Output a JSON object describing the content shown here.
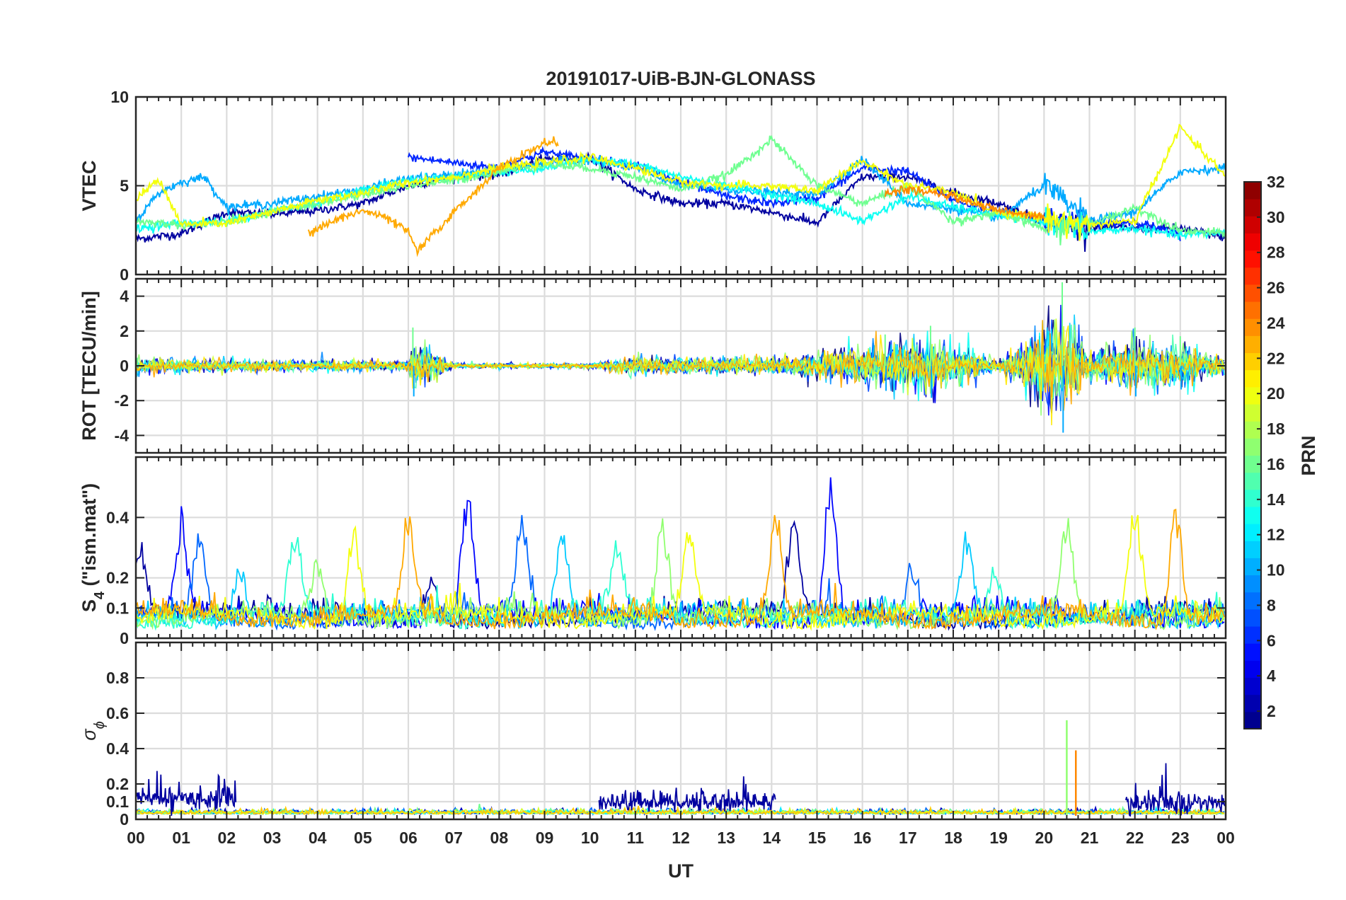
{
  "figure": {
    "title": "20191017-UiB-BJN-GLONASS",
    "xlabel": "UT",
    "colorbar_label": "PRN"
  },
  "chart_data": [
    {
      "type": "line",
      "panel": "VTEC",
      "ylabel": "VTEC",
      "ylim": [
        0,
        10
      ],
      "yticks": [
        0,
        5,
        10
      ],
      "xlim": [
        0,
        24
      ],
      "grid": true,
      "series_count_approx": 24,
      "series": [
        {
          "prn": 2,
          "x": [
            0,
            1,
            2,
            3,
            4,
            5,
            6,
            7,
            8,
            9,
            10,
            11,
            12,
            13,
            14,
            15,
            16,
            17,
            18,
            19,
            20,
            21,
            22,
            23,
            24
          ],
          "y": [
            2.0,
            2.3,
            3.5,
            3.4,
            3.6,
            4.0,
            5.0,
            5.5,
            5.6,
            6.5,
            6.6,
            4.8,
            4.0,
            4.0,
            3.5,
            2.9,
            5.5,
            5.5,
            4.6,
            4.0,
            3.0,
            2.7,
            2.6,
            2.6,
            2.1
          ]
        },
        {
          "prn": 6,
          "x": [
            6,
            7,
            8,
            8.5,
            9,
            10,
            11,
            12,
            13,
            14,
            15,
            16,
            17,
            18,
            19,
            20,
            21,
            22,
            23
          ],
          "y": [
            6.6,
            6.3,
            6.0,
            6.5,
            6.9,
            6.5,
            6.2,
            5.2,
            4.4,
            4.0,
            4.3,
            6.0,
            5.8,
            4.2,
            3.5,
            3.2,
            2.8,
            3.0,
            2.2
          ]
        },
        {
          "prn": 10,
          "x": [
            0,
            0.5,
            1,
            1.5,
            2,
            3,
            4,
            5,
            6,
            7,
            8,
            9,
            10,
            11,
            12,
            13,
            14,
            15,
            16,
            17,
            18,
            19,
            20,
            21,
            22,
            23,
            24
          ],
          "y": [
            3.0,
            4.6,
            5.2,
            5.5,
            3.8,
            4.0,
            4.4,
            4.8,
            5.4,
            5.6,
            5.9,
            6.3,
            6.5,
            6.0,
            5.0,
            4.8,
            4.6,
            4.5,
            6.5,
            4.0,
            3.7,
            3.2,
            5.0,
            3.0,
            3.5,
            5.8,
            6.0
          ]
        },
        {
          "prn": 13,
          "x": [
            0,
            1,
            2,
            3,
            4,
            5,
            6,
            7,
            8,
            9,
            10,
            11,
            12,
            13,
            14,
            15,
            16,
            17,
            18,
            19,
            20,
            21,
            22,
            23,
            24
          ],
          "y": [
            2.6,
            2.9,
            3.0,
            3.6,
            4.0,
            4.8,
            5.3,
            5.5,
            5.7,
            6.0,
            6.5,
            6.2,
            5.5,
            5.0,
            4.5,
            4.0,
            3.0,
            4.4,
            3.8,
            3.3,
            3.0,
            2.4,
            2.6,
            2.2,
            2.4
          ]
        },
        {
          "prn": 16,
          "x": [
            0,
            1,
            2,
            3,
            4,
            5,
            6,
            7,
            8,
            9,
            10,
            11,
            12,
            13,
            14,
            15,
            16,
            17,
            18,
            19,
            20,
            21,
            22,
            23,
            24
          ],
          "y": [
            3.0,
            2.8,
            2.9,
            3.5,
            4.0,
            4.5,
            5.0,
            5.3,
            5.8,
            6.2,
            6.0,
            5.5,
            4.8,
            5.6,
            7.6,
            5.0,
            4.0,
            5.0,
            3.0,
            3.5,
            2.6,
            2.8,
            3.8,
            2.5,
            2.3
          ]
        },
        {
          "prn": 20,
          "x": [
            0,
            0.5,
            1,
            2,
            3,
            4,
            5,
            6,
            7,
            8,
            9,
            10,
            11,
            12,
            13,
            14,
            15,
            16,
            17,
            18,
            19,
            20,
            21,
            22,
            23,
            24
          ],
          "y": [
            4.2,
            5.4,
            2.8,
            2.9,
            3.5,
            4.2,
            4.6,
            5.2,
            5.5,
            6.0,
            6.3,
            6.6,
            6.0,
            5.2,
            5.0,
            5.0,
            4.7,
            6.4,
            5.0,
            4.6,
            3.5,
            3.2,
            2.8,
            3.0,
            8.3,
            5.5
          ]
        },
        {
          "prn": 23,
          "x": [
            3.8,
            4.5,
            5,
            5.5,
            6,
            6.2,
            7,
            8,
            9,
            9.3
          ],
          "y": [
            2.3,
            3.2,
            3.6,
            3.2,
            2.4,
            1.3,
            3.5,
            6.0,
            7.4,
            7.5
          ]
        },
        {
          "prn": 24,
          "x": [
            16.5,
            17,
            18,
            19,
            20
          ],
          "y": [
            4.5,
            4.8,
            4.4,
            3.6,
            3.3
          ]
        }
      ]
    },
    {
      "type": "line",
      "panel": "ROT",
      "ylabel": "ROT [TECU/min]",
      "ylim": [
        -5,
        5
      ],
      "yticks": [
        -4,
        -2,
        0,
        2,
        4
      ],
      "xlim": [
        0,
        24
      ],
      "grid": true,
      "series_count_approx": 24,
      "envelope": [
        {
          "x": 0,
          "amplitude": 0.6
        },
        {
          "x": 2,
          "amplitude": 0.5
        },
        {
          "x": 6,
          "amplitude": 0.4
        },
        {
          "x": 6.1,
          "amplitude": 2.2
        },
        {
          "x": 7,
          "amplitude": 0.2
        },
        {
          "x": 10,
          "amplitude": 0.2
        },
        {
          "x": 11.1,
          "amplitude": 0.7
        },
        {
          "x": 14,
          "amplitude": 0.6
        },
        {
          "x": 16.5,
          "amplitude": 1.8
        },
        {
          "x": 17.5,
          "amplitude": 2.3
        },
        {
          "x": 19,
          "amplitude": 0.4
        },
        {
          "x": 20.4,
          "amplitude": 4.8
        },
        {
          "x": 21,
          "amplitude": 1.2
        },
        {
          "x": 22,
          "amplitude": 2.2
        },
        {
          "x": 23,
          "amplitude": 1.7
        },
        {
          "x": 24,
          "amplitude": 0.6
        }
      ]
    },
    {
      "type": "line",
      "panel": "S4",
      "ylabel": "S",
      "ylabel_subscript": "4",
      "ylabel_suffix": " (\"ism.mat\")",
      "ylim": [
        0,
        0.6
      ],
      "yticks": [
        0,
        0.1,
        0.2,
        0.4
      ],
      "xlim": [
        0,
        24
      ],
      "grid": true,
      "series_count_approx": 24,
      "baseline": 0.05,
      "spikes": [
        {
          "x": 0.1,
          "y": 0.31
        },
        {
          "x": 1.0,
          "y": 0.36
        },
        {
          "x": 1.4,
          "y": 0.36
        },
        {
          "x": 2.3,
          "y": 0.26
        },
        {
          "x": 3.5,
          "y": 0.34
        },
        {
          "x": 4.0,
          "y": 0.24
        },
        {
          "x": 4.8,
          "y": 0.4
        },
        {
          "x": 6.0,
          "y": 0.39
        },
        {
          "x": 6.5,
          "y": 0.19
        },
        {
          "x": 7.3,
          "y": 0.5
        },
        {
          "x": 8.5,
          "y": 0.4
        },
        {
          "x": 9.4,
          "y": 0.42
        },
        {
          "x": 10.6,
          "y": 0.31
        },
        {
          "x": 11.6,
          "y": 0.42
        },
        {
          "x": 12.2,
          "y": 0.36
        },
        {
          "x": 14.1,
          "y": 0.41
        },
        {
          "x": 14.5,
          "y": 0.4
        },
        {
          "x": 15.3,
          "y": 0.57
        },
        {
          "x": 17.1,
          "y": 0.21
        },
        {
          "x": 18.3,
          "y": 0.34
        },
        {
          "x": 18.9,
          "y": 0.25
        },
        {
          "x": 20.5,
          "y": 0.4
        },
        {
          "x": 22.0,
          "y": 0.42
        },
        {
          "x": 22.9,
          "y": 0.44
        }
      ]
    },
    {
      "type": "line",
      "panel": "sigma_phi",
      "ylabel": "σ",
      "ylabel_subscript": "ϕ",
      "ylim": [
        0,
        1
      ],
      "yticks": [
        0,
        0.1,
        0.2,
        0.4,
        0.6,
        0.8
      ],
      "xlim": [
        0,
        24
      ],
      "grid": true,
      "series_count_approx": 24,
      "baseline": 0.03,
      "bursts": [
        {
          "x_start": 0,
          "x_end": 2.2,
          "level": 0.12,
          "peak": 0.25
        },
        {
          "x_start": 10.2,
          "x_end": 14.1,
          "level": 0.1,
          "peak": 0.26
        },
        {
          "x_start": 21.8,
          "x_end": 24,
          "level": 0.09,
          "peak": 0.23
        }
      ],
      "spikes": [
        {
          "x": 20.5,
          "y": 0.56
        },
        {
          "x": 20.7,
          "y": 0.39
        }
      ]
    }
  ],
  "x_axis": {
    "range": [
      0,
      24
    ],
    "tick_labels": [
      "00",
      "01",
      "02",
      "03",
      "04",
      "05",
      "06",
      "07",
      "08",
      "09",
      "10",
      "11",
      "12",
      "13",
      "14",
      "15",
      "16",
      "17",
      "18",
      "19",
      "20",
      "21",
      "22",
      "23",
      "00"
    ]
  },
  "colorbar": {
    "colormap": "jet",
    "range": [
      1,
      32
    ],
    "ticks": [
      2,
      4,
      6,
      8,
      10,
      12,
      14,
      16,
      18,
      20,
      22,
      24,
      26,
      28,
      30,
      32
    ],
    "tick_labels": [
      "2",
      "4",
      "6",
      "8",
      "10",
      "12",
      "14",
      "16",
      "18",
      "20",
      "22",
      "24",
      "26",
      "28",
      "30",
      "32"
    ]
  },
  "colors": {
    "axis": "#262626",
    "grid": "#dcdcdc",
    "background": "#ffffff"
  }
}
